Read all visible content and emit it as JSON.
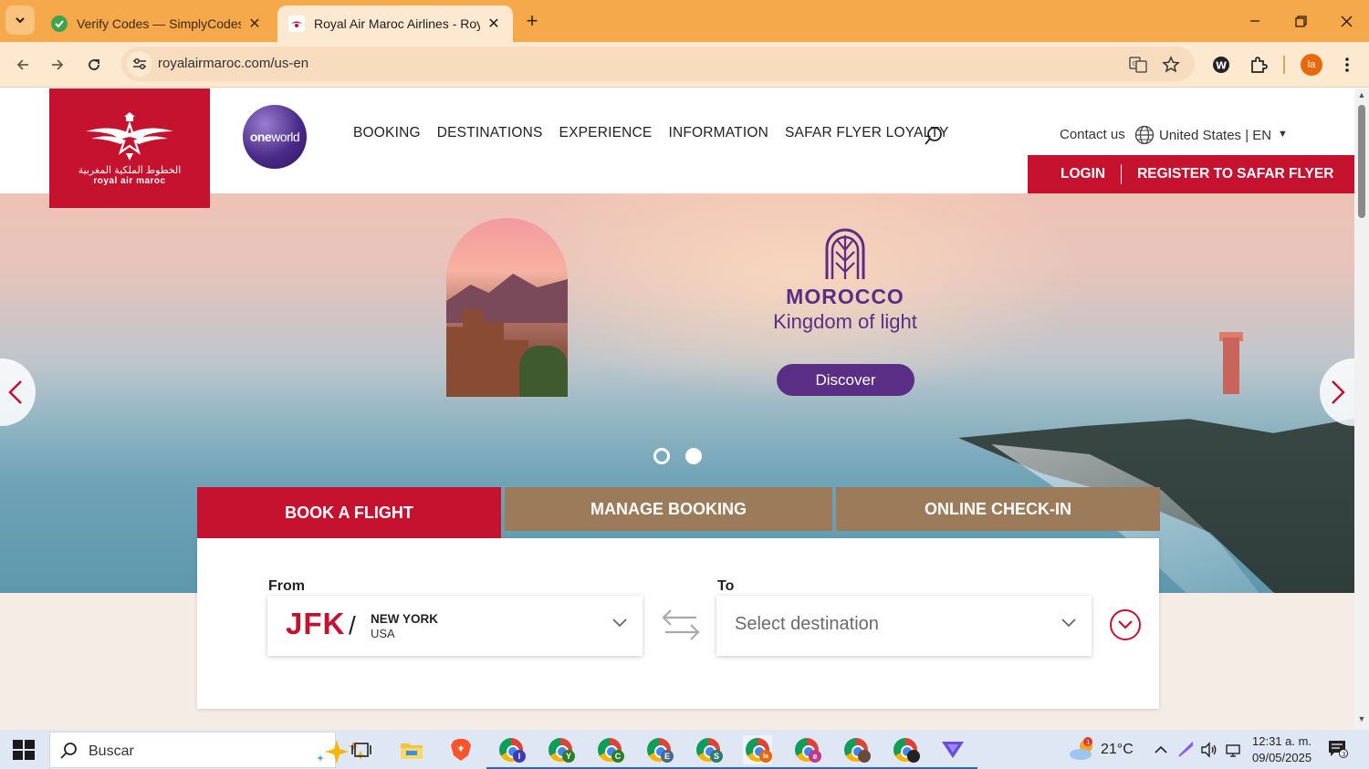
{
  "browser": {
    "tabs": [
      {
        "title": "Verify Codes — SimplyCodes",
        "active": false
      },
      {
        "title": "Royal Air Maroc Airlines - Royal",
        "active": true
      }
    ],
    "url": "royalairmaroc.com/us-en",
    "profile_initials": "la"
  },
  "site": {
    "logo": {
      "arabic": "الخطوط الملكية المغربية",
      "latin": "royal air maroc"
    },
    "oneworld": {
      "one": "one",
      "world": "world"
    },
    "nav": [
      "BOOKING",
      "DESTINATIONS",
      "EXPERIENCE",
      "INFORMATION",
      "SAFAR FLYER LOYALTY"
    ],
    "contact": "Contact us",
    "locale": "United States | EN",
    "login": "LOGIN",
    "register": "REGISTER TO SAFAR FLYER"
  },
  "hero": {
    "title": "MOROCCO",
    "subtitle": "Kingdom of light",
    "cta": "Discover",
    "slide_count": 2,
    "active_slide": 2
  },
  "booking": {
    "tabs": [
      "BOOK A FLIGHT",
      "MANAGE BOOKING",
      "ONLINE CHECK-IN"
    ],
    "from_label": "From",
    "to_label": "To",
    "from_code": "JFK",
    "from_separator": "/",
    "from_city": "NEW YORK",
    "from_country": "USA",
    "to_placeholder": "Select destination"
  },
  "taskbar": {
    "search_placeholder": "Buscar",
    "apps": [
      {
        "icon": "chrome-icon",
        "badge": "I",
        "badge_color": "#3b3bb3"
      },
      {
        "icon": "chrome-icon",
        "badge": "Y",
        "badge_color": "#2d7d2d"
      },
      {
        "icon": "chrome-icon",
        "badge": "C",
        "badge_color": "#2d7d2d"
      },
      {
        "icon": "chrome-icon",
        "badge": "E",
        "badge_color": "#4a6a8a"
      },
      {
        "icon": "chrome-icon",
        "badge": "S",
        "badge_color": "#2d7d6d"
      },
      {
        "icon": "chrome-icon",
        "badge": "la",
        "badge_color": "#e8680a"
      },
      {
        "icon": "chrome-icon",
        "badge": "e",
        "badge_color": "#c03a8a"
      },
      {
        "icon": "chrome-icon",
        "badge": "",
        "badge_color": "#6a4a3a"
      },
      {
        "icon": "chrome-icon",
        "badge": "",
        "badge_color": "#222222"
      }
    ],
    "weather_temp": "21°C",
    "weather_alert": "1",
    "time": "12:31 a. m.",
    "date": "09/05/2025",
    "notification_count": "3"
  },
  "colors": {
    "brand_red": "#c4122f",
    "brand_purple": "#5b2e86",
    "tab_brown": "#9b7b5a",
    "tabstrip": "#f6a94b"
  }
}
